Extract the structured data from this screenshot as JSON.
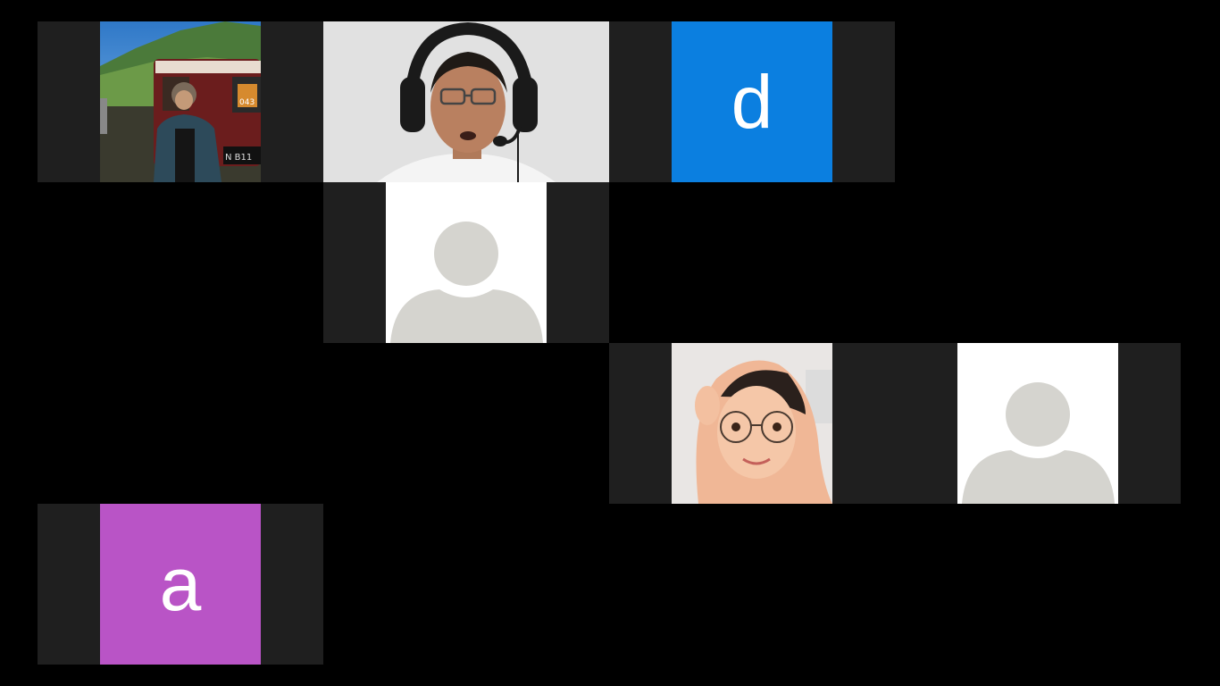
{
  "app": {
    "view": "gallery-view"
  },
  "participants": [
    {
      "kind": "video",
      "scene": "outdoor-mountain-jeep",
      "jeep_plate": "N B11",
      "jeep_number": "043"
    },
    {
      "kind": "video",
      "scene": "man-with-headset"
    },
    {
      "kind": "initial",
      "initial": "d",
      "color": "#0b7fe0"
    },
    {
      "kind": "placeholder",
      "icon": "default-user-icon"
    },
    {
      "kind": "video",
      "scene": "woman-with-hijab-glasses"
    },
    {
      "kind": "placeholder",
      "icon": "default-user-icon"
    },
    {
      "kind": "initial",
      "initial": "a",
      "color": "#b954c6"
    }
  ],
  "colors": {
    "background": "#000000",
    "tile_bg": "#1f1f1f",
    "placeholder_silhouette": "#d5d4cf"
  }
}
